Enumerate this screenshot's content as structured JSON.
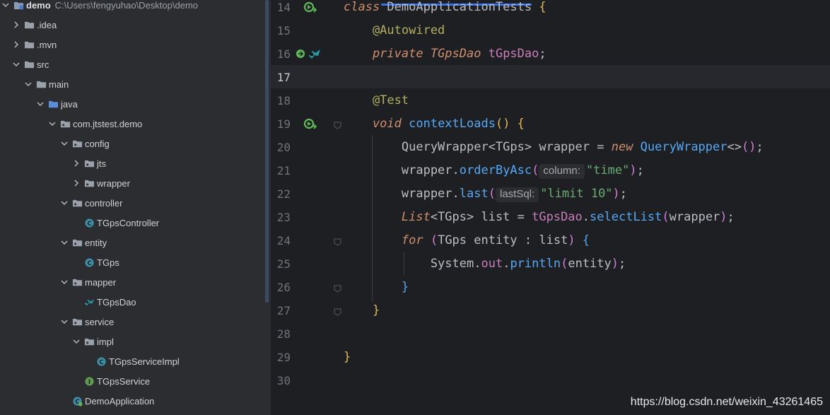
{
  "project_tree": {
    "root": {
      "label": "demo",
      "path": "C:\\Users\\fengyuhao\\Desktop\\demo"
    },
    "items": [
      {
        "label": ".idea",
        "indent": 1,
        "chevron": "right",
        "icon": "folder-icon"
      },
      {
        "label": ".mvn",
        "indent": 1,
        "chevron": "right",
        "icon": "folder-icon"
      },
      {
        "label": "src",
        "indent": 1,
        "chevron": "down",
        "icon": "folder-icon"
      },
      {
        "label": "main",
        "indent": 2,
        "chevron": "down",
        "icon": "folder-icon"
      },
      {
        "label": "java",
        "indent": 3,
        "chevron": "down",
        "icon": "source-folder-icon"
      },
      {
        "label": "com.jtstest.demo",
        "indent": 4,
        "chevron": "down",
        "icon": "package-icon"
      },
      {
        "label": "config",
        "indent": 5,
        "chevron": "down",
        "icon": "package-icon"
      },
      {
        "label": "jts",
        "indent": 6,
        "chevron": "right",
        "icon": "package-icon"
      },
      {
        "label": "wrapper",
        "indent": 6,
        "chevron": "right",
        "icon": "package-icon"
      },
      {
        "label": "controller",
        "indent": 5,
        "chevron": "down",
        "icon": "package-icon"
      },
      {
        "label": "TGpsController",
        "indent": 6,
        "chevron": "none",
        "icon": "class-icon"
      },
      {
        "label": "entity",
        "indent": 5,
        "chevron": "down",
        "icon": "package-icon"
      },
      {
        "label": "TGps",
        "indent": 6,
        "chevron": "none",
        "icon": "class-icon"
      },
      {
        "label": "mapper",
        "indent": 5,
        "chevron": "down",
        "icon": "package-icon"
      },
      {
        "label": "TGpsDao",
        "indent": 6,
        "chevron": "none",
        "icon": "mybatis-icon"
      },
      {
        "label": "service",
        "indent": 5,
        "chevron": "down",
        "icon": "package-icon"
      },
      {
        "label": "impl",
        "indent": 6,
        "chevron": "down",
        "icon": "package-icon"
      },
      {
        "label": "TGpsServiceImpl",
        "indent": 7,
        "chevron": "none",
        "icon": "class-icon"
      },
      {
        "label": "TGpsService",
        "indent": 6,
        "chevron": "none",
        "icon": "interface-icon"
      },
      {
        "label": "DemoApplication",
        "indent": 5,
        "chevron": "none",
        "icon": "spring-boot-class-icon"
      }
    ]
  },
  "editor": {
    "current_line": 17,
    "lines": [
      {
        "no": "14",
        "tokens": [
          [
            "kw",
            "class"
          ],
          [
            "ty",
            " DemoApplicationTests "
          ],
          [
            "br1",
            "{"
          ]
        ],
        "gutter": "run-icon"
      },
      {
        "no": "15",
        "tokens": [
          [
            "ann",
            "    @Autowired"
          ]
        ]
      },
      {
        "no": "16",
        "tokens": [
          [
            "kwp",
            "    private "
          ],
          [
            "kwp",
            "TGpsDao "
          ],
          [
            "fld",
            "tGpsDao"
          ],
          [
            "ty",
            ";"
          ]
        ],
        "gutter": "bean-mybatis-icon"
      },
      {
        "no": "17",
        "tokens": []
      },
      {
        "no": "18",
        "tokens": [
          [
            "ann",
            "    @Test"
          ]
        ]
      },
      {
        "no": "19",
        "tokens": [
          [
            "kw",
            "    void "
          ],
          [
            "fn",
            "contextLoads"
          ],
          [
            "br1",
            "() "
          ],
          [
            "br1",
            "{"
          ]
        ],
        "gutter": "run-icon",
        "fold": true
      },
      {
        "no": "20",
        "tokens": [
          [
            "ty",
            "        QueryWrapper<TGps> "
          ],
          [
            "var",
            "wrapper"
          ],
          [
            "ty",
            " = "
          ],
          [
            "kw",
            "new "
          ],
          [
            "fn",
            "QueryWrapper"
          ],
          [
            "ty",
            "<>"
          ],
          [
            "br2",
            "()"
          ],
          [
            "ty",
            ";"
          ]
        ]
      },
      {
        "no": "21",
        "tokens": [
          [
            "var",
            "        wrapper"
          ],
          [
            "ty",
            "."
          ],
          [
            "fn",
            "orderByAsc"
          ],
          [
            "br2",
            "("
          ],
          [
            "hint",
            "column:"
          ],
          [
            "str",
            "\"time\""
          ],
          [
            "br2",
            ")"
          ],
          [
            "ty",
            ";"
          ]
        ]
      },
      {
        "no": "22",
        "tokens": [
          [
            "var",
            "        wrapper"
          ],
          [
            "ty",
            "."
          ],
          [
            "fn",
            "last"
          ],
          [
            "br2",
            "("
          ],
          [
            "hint",
            "lastSql:"
          ],
          [
            "str",
            "\"limit 10\""
          ],
          [
            "br2",
            ")"
          ],
          [
            "ty",
            ";"
          ]
        ]
      },
      {
        "no": "23",
        "tokens": [
          [
            "kw",
            "        List"
          ],
          [
            "ty",
            "<TGps> list = "
          ],
          [
            "fld",
            "tGpsDao"
          ],
          [
            "ty",
            "."
          ],
          [
            "fn",
            "selectList"
          ],
          [
            "br2",
            "("
          ],
          [
            "var",
            "wrapper"
          ],
          [
            "br2",
            ")"
          ],
          [
            "ty",
            ";"
          ]
        ]
      },
      {
        "no": "24",
        "tokens": [
          [
            "kw",
            "        for "
          ],
          [
            "br2",
            "("
          ],
          [
            "ty",
            "TGps entity : list"
          ],
          [
            "br2",
            ") "
          ],
          [
            "br3",
            "{"
          ]
        ],
        "fold": true
      },
      {
        "no": "25",
        "tokens": [
          [
            "ty",
            "            System."
          ],
          [
            "fld",
            "out"
          ],
          [
            "ty",
            "."
          ],
          [
            "fn",
            "println"
          ],
          [
            "br2",
            "("
          ],
          [
            "var",
            "entity"
          ],
          [
            "br2",
            ")"
          ],
          [
            "ty",
            ";"
          ]
        ]
      },
      {
        "no": "26",
        "tokens": [
          [
            "br3",
            "        }"
          ]
        ],
        "fold": true
      },
      {
        "no": "27",
        "tokens": [
          [
            "br1",
            "    }"
          ]
        ],
        "fold": true
      },
      {
        "no": "28",
        "tokens": []
      },
      {
        "no": "29",
        "tokens": [
          [
            "br1",
            "}"
          ]
        ]
      },
      {
        "no": "30",
        "tokens": []
      }
    ]
  },
  "watermark": "https://blog.csdn.net/weixin_43261465",
  "colors": {
    "tree_bg": "#2b2d30",
    "editor_bg": "#1e1f22",
    "keyword": "#cf8e6d",
    "annotation": "#b3ae60",
    "string": "#6aab73",
    "method": "#56a8f5",
    "field": "#c77dbb"
  }
}
